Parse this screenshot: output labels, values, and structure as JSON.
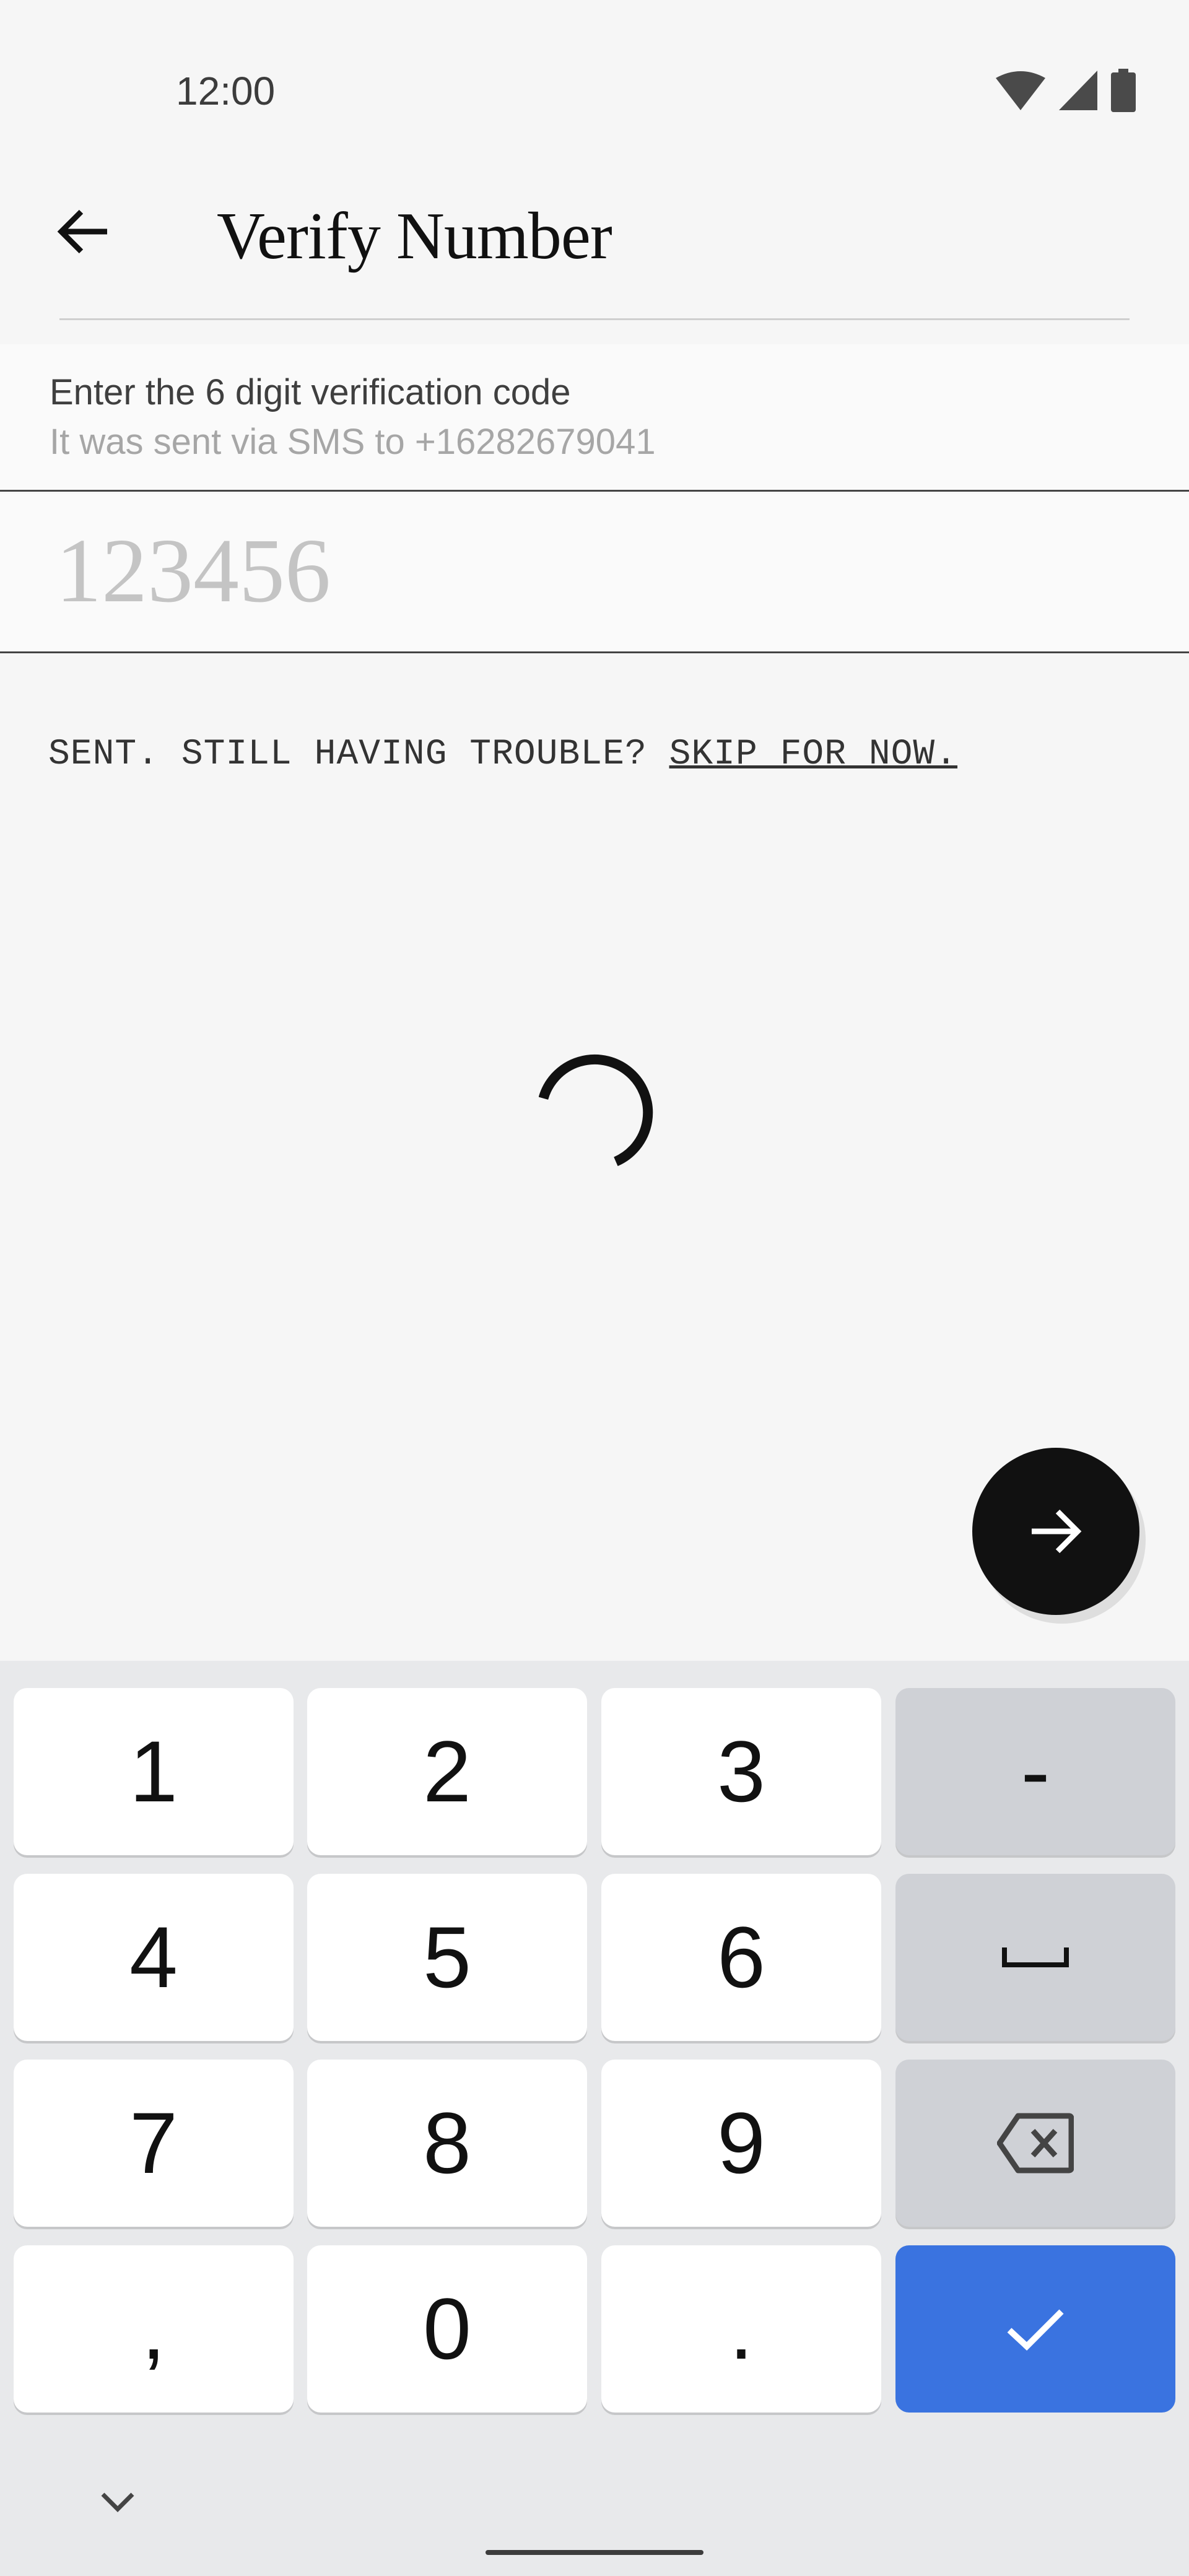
{
  "status_bar": {
    "time": "12:00",
    "icons": [
      "wifi-icon",
      "cellular-signal-icon",
      "battery-icon"
    ]
  },
  "app_bar": {
    "back_icon": "arrow-left-icon",
    "title": "Verify Number"
  },
  "instructions": {
    "primary": "Enter the 6 digit verification code",
    "secondary": "It was sent via SMS to +16282679041"
  },
  "code_input": {
    "value": "",
    "placeholder": "123456"
  },
  "trouble": {
    "text": "SENT. STILL HAVING TROUBLE? ",
    "link": "SKIP FOR NOW."
  },
  "loading": {
    "icon": "loading-spinner-icon"
  },
  "fab": {
    "icon": "arrow-right-icon"
  },
  "keyboard": {
    "keys": [
      [
        "1",
        "2",
        "3",
        "-"
      ],
      [
        "4",
        "5",
        "6",
        "space"
      ],
      [
        "7",
        "8",
        "9",
        "backspace"
      ],
      [
        ",",
        "0",
        ".",
        "done"
      ]
    ],
    "labels": {
      "k1": "1",
      "k2": "2",
      "k3": "3",
      "dash": "-",
      "k4": "4",
      "k5": "5",
      "k6": "6",
      "k7": "7",
      "k8": "8",
      "k9": "9",
      "comma": ",",
      "k0": "0",
      "period": "."
    },
    "hide_icon": "chevron-down-icon",
    "colors": {
      "keys": "#ffffff",
      "function_keys": "#cfd1d6",
      "enter": "#3a73e0",
      "background": "#e8e9eb"
    }
  }
}
